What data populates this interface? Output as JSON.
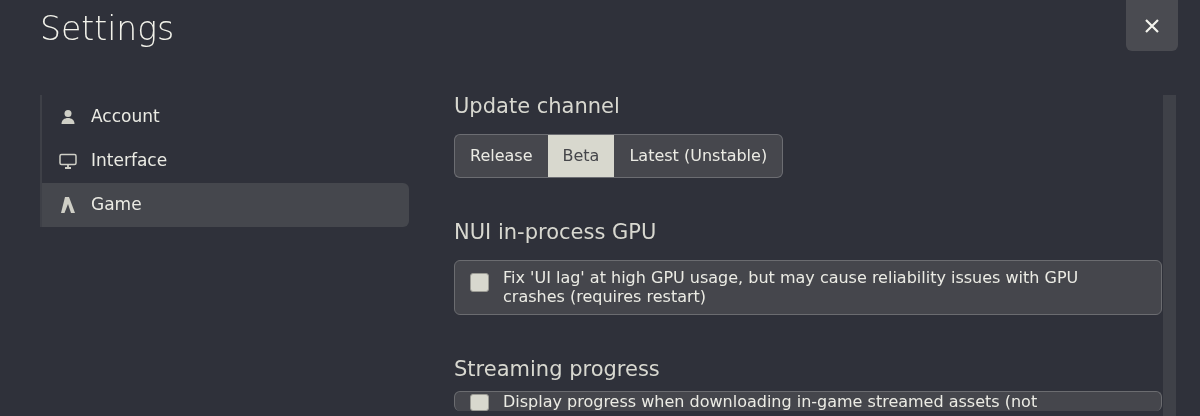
{
  "title": "Settings",
  "sidebar": {
    "items": [
      {
        "label": "Account",
        "kind": "person",
        "selected": false
      },
      {
        "label": "Interface",
        "kind": "monitor",
        "selected": false
      },
      {
        "label": "Game",
        "kind": "logo",
        "selected": true
      }
    ]
  },
  "sections": [
    {
      "heading": "Update channel",
      "kind": "segmented",
      "options": [
        {
          "label": "Release",
          "selected": false
        },
        {
          "label": "Beta",
          "selected": true
        },
        {
          "label": "Latest (Unstable)",
          "selected": false
        }
      ]
    },
    {
      "heading": "NUI in-process GPU",
      "kind": "checkbox",
      "label": "Fix 'UI lag' at high GPU usage, but may cause reliability issues with GPU crashes (requires restart)",
      "checked": false
    },
    {
      "heading": "Streaming progress",
      "kind": "checkbox",
      "label": "Display progress when downloading in-game streamed assets (not",
      "checked": false
    }
  ]
}
